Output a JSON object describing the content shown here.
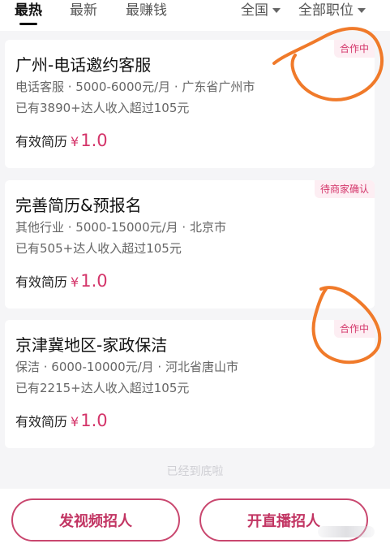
{
  "filter_bar": {
    "tabs": [
      "最热",
      "最新",
      "最赚钱"
    ],
    "active_tab": "最热",
    "region": "全国",
    "category": "全部职位"
  },
  "jobs": [
    {
      "title": "广州-电话邀约客服",
      "meta": "电话客服 · 5000-6000元/月 · 广东省广州市",
      "stat": "已有3890+达人收入超过105元",
      "reward_label": "有效简历",
      "reward_currency": "¥",
      "reward_value": "1.0",
      "status": "合作中"
    },
    {
      "title": "完善简历&预报名",
      "meta": "其他行业 · 5000-15000元/月 · 北京市",
      "stat": "已有505+达人收入超过105元",
      "reward_label": "有效简历",
      "reward_currency": "¥",
      "reward_value": "1.0",
      "status": "待商家确认"
    },
    {
      "title": "京津冀地区-家政保洁",
      "meta": "保洁 · 6000-10000元/月 · 河北省唐山市",
      "stat": "已有2215+达人收入超过105元",
      "reward_label": "有效简历",
      "reward_currency": "¥",
      "reward_value": "1.0",
      "status": "合作中"
    }
  ],
  "end_of_list": "已经到底啦",
  "actions": {
    "video_recruit": "发视频招人",
    "live_recruit": "开直播招人"
  },
  "colors": {
    "accent": "#d4356a",
    "annotation": "#f07a2a"
  }
}
